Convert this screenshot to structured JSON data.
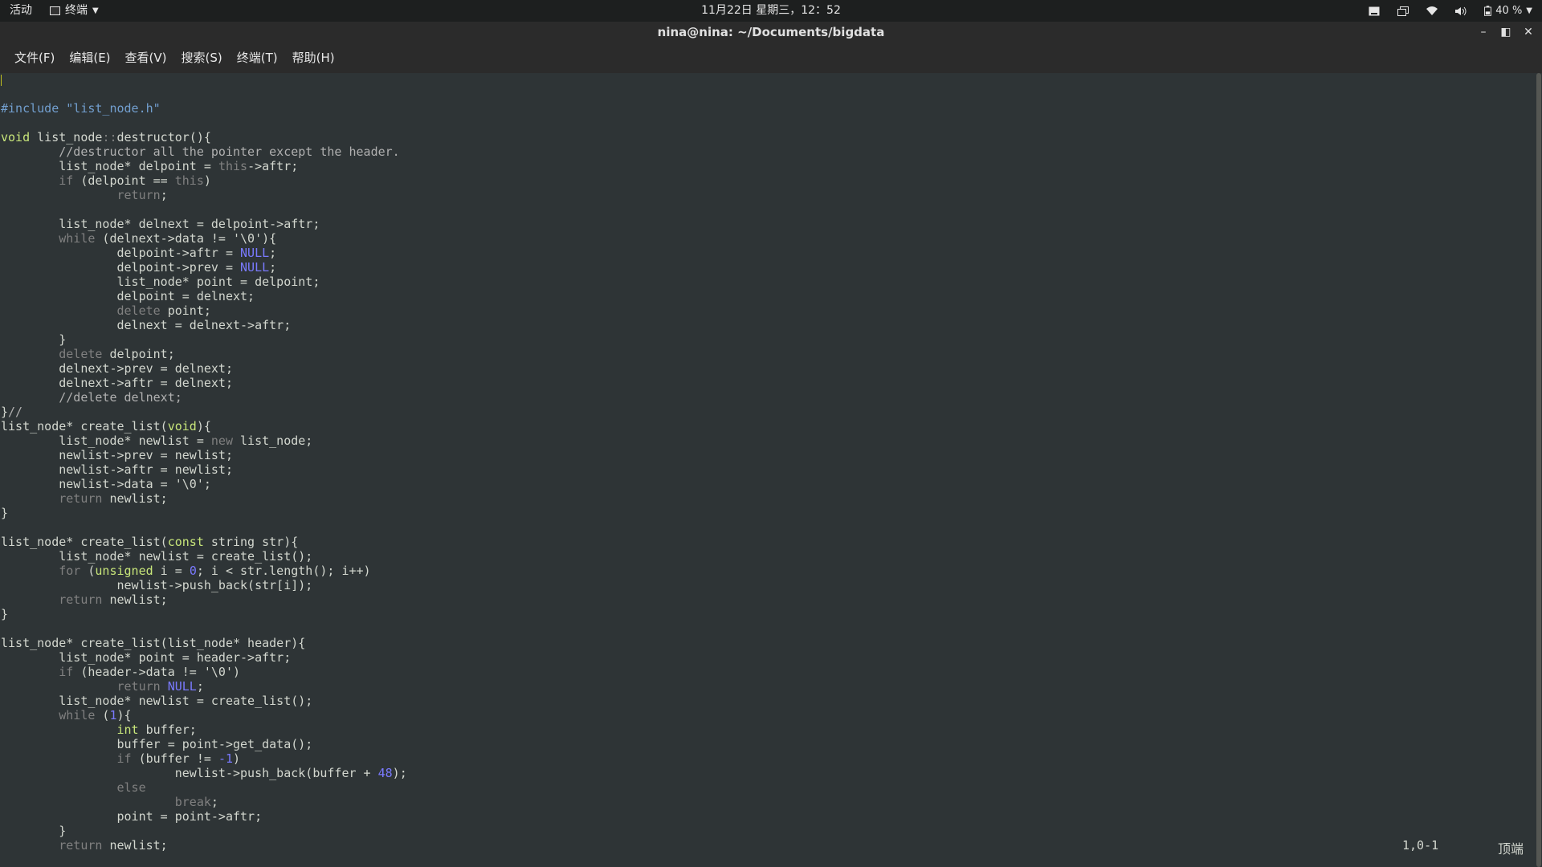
{
  "topbar": {
    "activities": "活动",
    "app_menu": "终端",
    "clock": "11月22日 星期三，12：52",
    "battery": "40 %"
  },
  "window": {
    "title": "nina@nina: ~/Documents/bigdata"
  },
  "menubar": {
    "items": [
      "文件(F)",
      "编辑(E)",
      "查看(V)",
      "搜索(S)",
      "终端(T)",
      "帮助(H)"
    ]
  },
  "editor": {
    "lines": [
      "",
      "#include \"list_node.h\"",
      "",
      "void list_node::destructor(){",
      "        //destructor all the pointer except the header.",
      "        list_node* delpoint = this->aftr;",
      "        if (delpoint == this)",
      "                return;",
      "",
      "        list_node* delnext = delpoint->aftr;",
      "        while (delnext->data != '\\0'){",
      "                delpoint->aftr = NULL;",
      "                delpoint->prev = NULL;",
      "                list_node* point = delpoint;",
      "                delpoint = delnext;",
      "                delete point;",
      "                delnext = delnext->aftr;",
      "        }",
      "        delete delpoint;",
      "        delnext->prev = delnext;",
      "        delnext->aftr = delnext;",
      "        //delete delnext;",
      "}//",
      "list_node* create_list(void){",
      "        list_node* newlist = new list_node;",
      "        newlist->prev = newlist;",
      "        newlist->aftr = newlist;",
      "        newlist->data = '\\0';",
      "        return newlist;",
      "}",
      "",
      "list_node* create_list(const string str){",
      "        list_node* newlist = create_list();",
      "        for (unsigned i = 0; i < str.length(); i++)",
      "                newlist->push_back(str[i]);",
      "        return newlist;",
      "}",
      "",
      "list_node* create_list(list_node* header){",
      "        list_node* point = header->aftr;",
      "        if (header->data != '\\0')",
      "                return NULL;",
      "        list_node* newlist = create_list();",
      "        while (1){",
      "                int buffer;",
      "                buffer = point->get_data();",
      "                if (buffer != -1)",
      "                        newlist->push_back(buffer + 48);",
      "                else",
      "                        break;",
      "                point = point->aftr;",
      "        }",
      "        return newlist;"
    ]
  },
  "status": {
    "cursor_position": "1,0-1",
    "scroll_position": "顶端"
  }
}
